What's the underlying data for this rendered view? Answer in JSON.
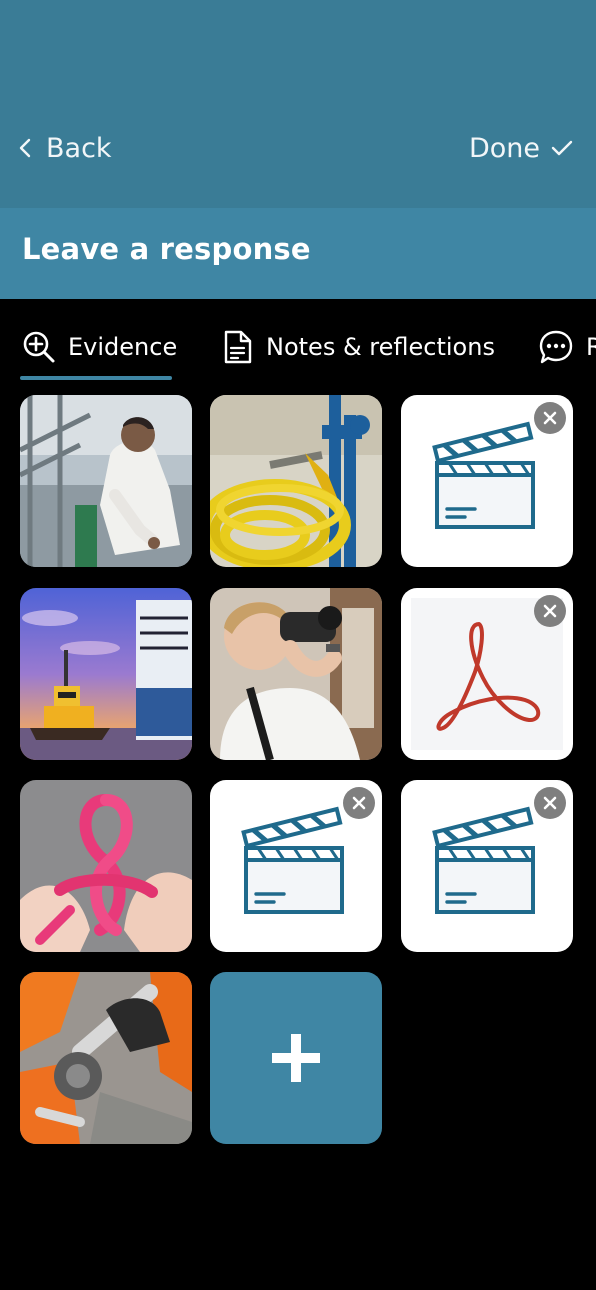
{
  "nav": {
    "back_label": "Back",
    "done_label": "Done"
  },
  "page": {
    "title": "Leave a response"
  },
  "tabs": [
    {
      "label": "Evidence",
      "icon": "search-plus-icon",
      "active": true
    },
    {
      "label": "Notes & reflections",
      "icon": "document-icon",
      "active": false
    },
    {
      "label": "R",
      "icon": "chat-bubble-icon",
      "active": false
    }
  ],
  "evidence": {
    "items": [
      {
        "kind": "photo",
        "subject": "crew member in white overalls on ship deck"
      },
      {
        "kind": "photo",
        "subject": "yellow hose coiled beside blue valve"
      },
      {
        "kind": "video",
        "icon": "clapperboard-icon",
        "removable": true
      },
      {
        "kind": "photo",
        "subject": "tugboat beside container ship at sunset"
      },
      {
        "kind": "photo",
        "subject": "officer looking through binoculars"
      },
      {
        "kind": "pdf",
        "icon": "acrobat-pdf-icon",
        "removable": true
      },
      {
        "kind": "photo",
        "subject": "hands tying pink rope knot"
      },
      {
        "kind": "video",
        "icon": "clapperboard-icon",
        "removable": true
      },
      {
        "kind": "video",
        "icon": "clapperboard-icon",
        "removable": true
      },
      {
        "kind": "photo",
        "subject": "gloved hands using wrench on valve"
      }
    ],
    "add_button_icon": "plus-icon"
  },
  "colors": {
    "navbar": "#3a7c96",
    "accent": "#3f86a4",
    "background": "#000000",
    "clapper": "#1f6a8c",
    "pdf": "#c0392b"
  }
}
